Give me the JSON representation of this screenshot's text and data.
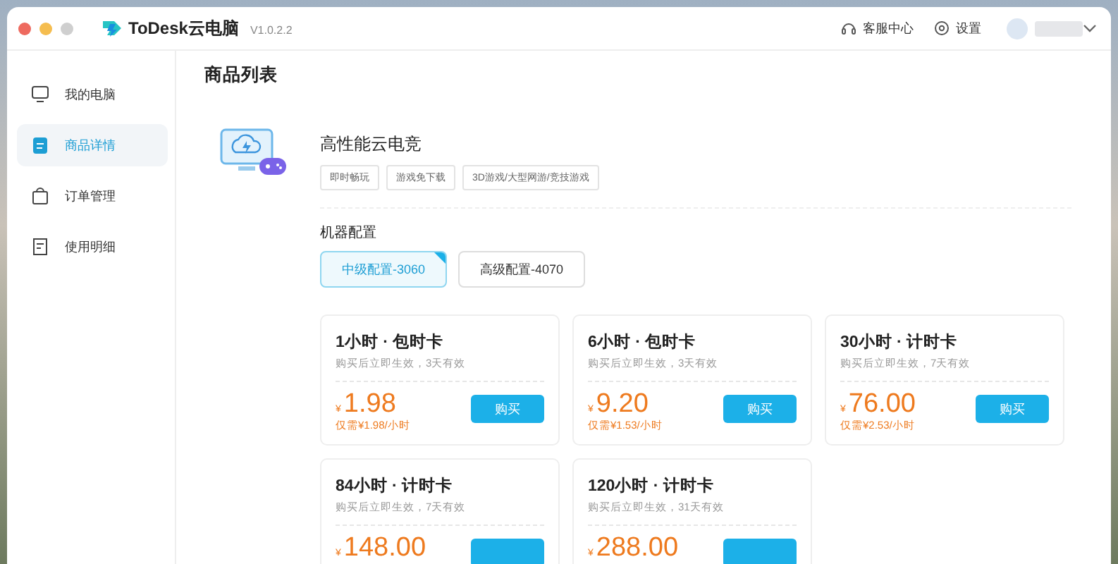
{
  "app": {
    "name": "ToDesk云电脑",
    "version": "V1.0.2.2"
  },
  "topbar": {
    "items": [
      {
        "label": "客服中心"
      },
      {
        "label": "设置"
      }
    ]
  },
  "sidebar": {
    "items": [
      {
        "label": "我的电脑",
        "selected": false
      },
      {
        "label": "商品详情",
        "selected": true
      },
      {
        "label": "订单管理",
        "selected": false
      },
      {
        "label": "使用明细",
        "selected": false
      }
    ]
  },
  "page_title": "商品列表",
  "product": {
    "name": "高性能云电竞",
    "tags": [
      "即时畅玩",
      "游戏免下载",
      "3D游戏/大型网游/竞技游戏"
    ]
  },
  "config": {
    "label": "机器配置",
    "options": [
      {
        "label": "中级配置-3060",
        "selected": true
      },
      {
        "label": "高级配置-4070",
        "selected": false
      }
    ]
  },
  "cards": [
    {
      "title": "1小时 · 包时卡",
      "note": "购买后立即生效，3天有效",
      "currency": "¥",
      "price": "1.98",
      "unit_price": "仅需¥1.98/小时",
      "button": "购买"
    },
    {
      "title": "6小时 · 包时卡",
      "note": "购买后立即生效，3天有效",
      "currency": "¥",
      "price": "9.20",
      "unit_price": "仅需¥1.53/小时",
      "button": "购买"
    },
    {
      "title": "30小时 · 计时卡",
      "note": "购买后立即生效，7天有效",
      "currency": "¥",
      "price": "76.00",
      "unit_price": "仅需¥2.53/小时",
      "button": "购买"
    },
    {
      "title": "84小时 · 计时卡",
      "note": "购买后立即生效，7天有效",
      "currency": "¥",
      "price": "148.00"
    },
    {
      "title": "120小时 · 计时卡",
      "note": "购买后立即生效，31天有效",
      "currency": "¥",
      "price": "288.00"
    }
  ]
}
